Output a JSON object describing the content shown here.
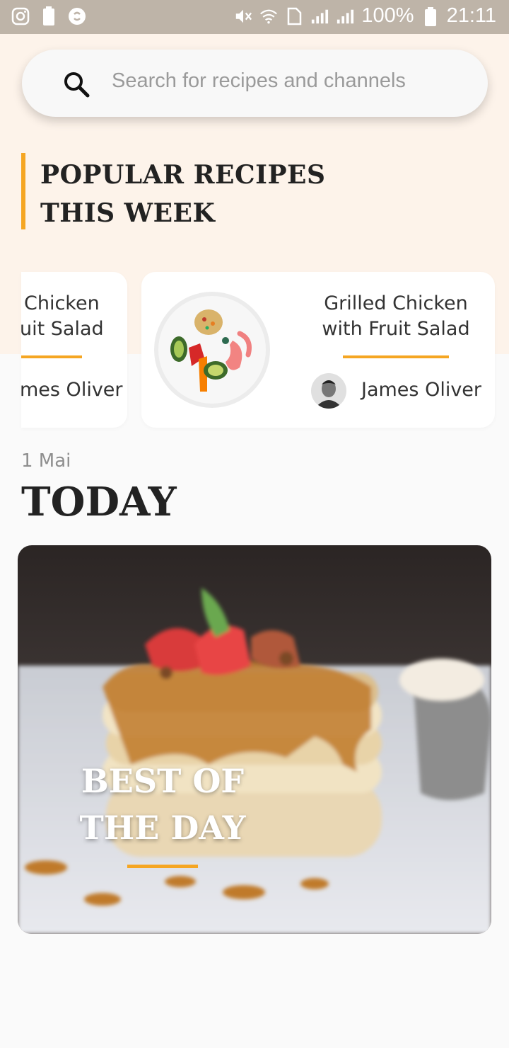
{
  "status_bar": {
    "battery": "100%",
    "time": "21:11"
  },
  "search": {
    "placeholder": "Search for recipes and channels"
  },
  "popular": {
    "title": "POPULAR RECIPES THIS WEEK",
    "cards": [
      {
        "title_line1": "Chicken",
        "title_line2": "uit Salad",
        "author": "mes Oliver"
      },
      {
        "title_line1": "Grilled Chicken",
        "title_line2": "with Fruit Salad",
        "author": "James Oliver"
      }
    ]
  },
  "today": {
    "date": "1 Mai",
    "heading": "TODAY",
    "hero_line1": "BEST OF",
    "hero_line2": "THE DAY"
  },
  "colors": {
    "accent": "#f5a623",
    "peach": "#fdf3ea",
    "status_bar": "#beb4a8"
  }
}
